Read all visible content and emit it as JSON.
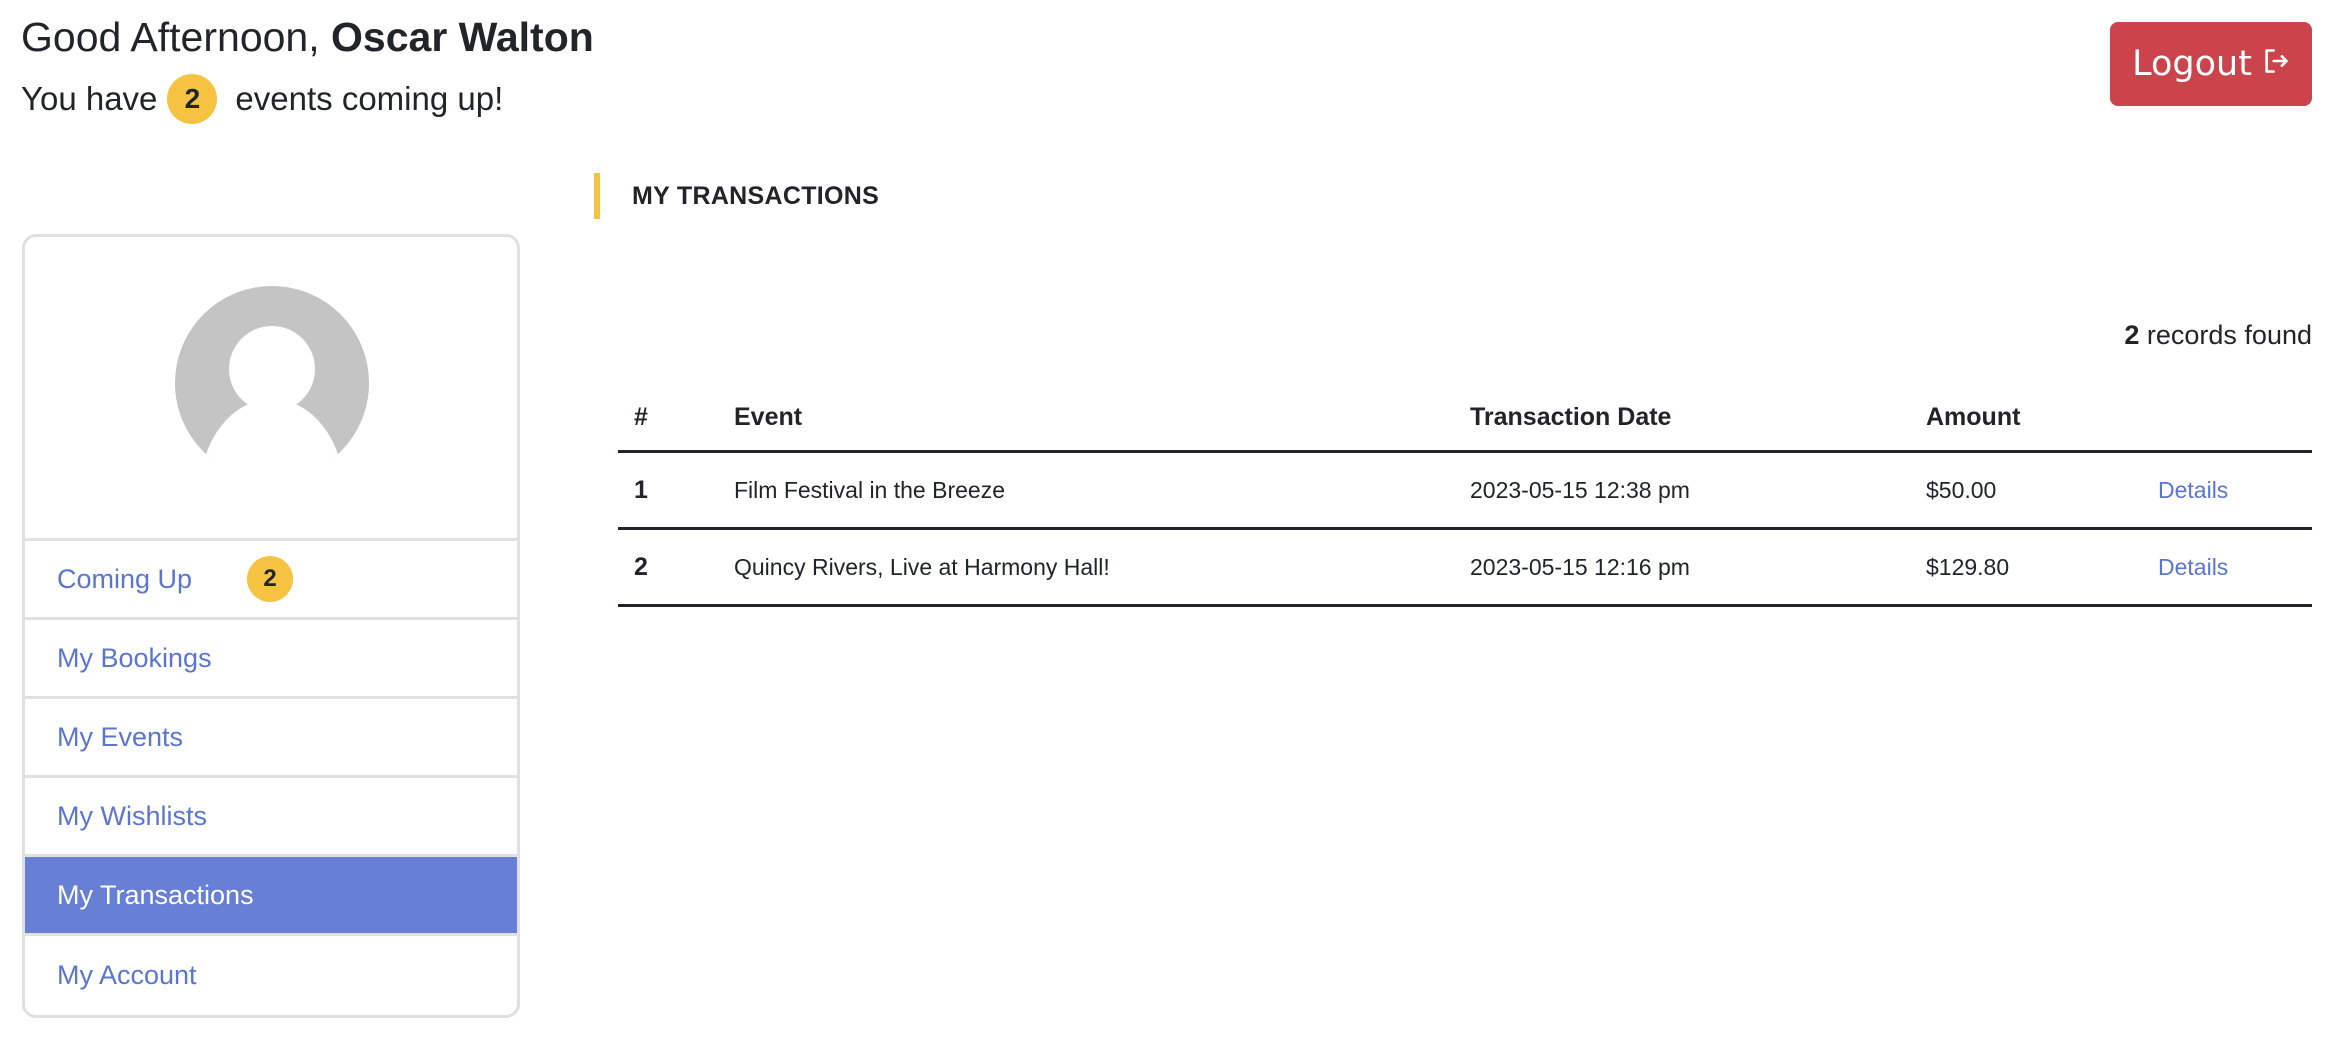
{
  "header": {
    "greeting_prefix": "Good Afternoon,",
    "user_name": "Oscar Walton",
    "subline_prefix": "You have",
    "upcoming_count": "2",
    "subline_suffix": "events coming up!",
    "logout_label": "Logout",
    "logout_icon": "logout-arrow-icon"
  },
  "sidebar": {
    "avatar_icon": "default-user-avatar",
    "items": [
      {
        "label": "Coming Up",
        "badge": "2",
        "active": false
      },
      {
        "label": "My Bookings",
        "active": false
      },
      {
        "label": "My Events",
        "active": false
      },
      {
        "label": "My Wishlists",
        "active": false
      },
      {
        "label": "My Transactions",
        "active": true
      },
      {
        "label": "My Account",
        "active": false
      }
    ]
  },
  "main": {
    "section_title": "MY TRANSACTIONS",
    "records_count": "2",
    "records_suffix": " records found",
    "table": {
      "columns": [
        "#",
        "Event",
        "Transaction Date",
        "Amount",
        ""
      ],
      "rows": [
        {
          "num": "1",
          "event": "Film Festival in the Breeze",
          "date": "2023-05-15 12:38 pm",
          "amount": "$50.00",
          "action": "Details"
        },
        {
          "num": "2",
          "event": "Quincy Rivers, Live at Harmony Hall!",
          "date": "2023-05-15 12:16 pm",
          "amount": "$129.80",
          "action": "Details"
        }
      ]
    }
  },
  "colors": {
    "accent_blue": "#687fd6",
    "link_blue": "#5b75d0",
    "badge_yellow": "#f5c242",
    "logout_red": "#cc444b"
  }
}
